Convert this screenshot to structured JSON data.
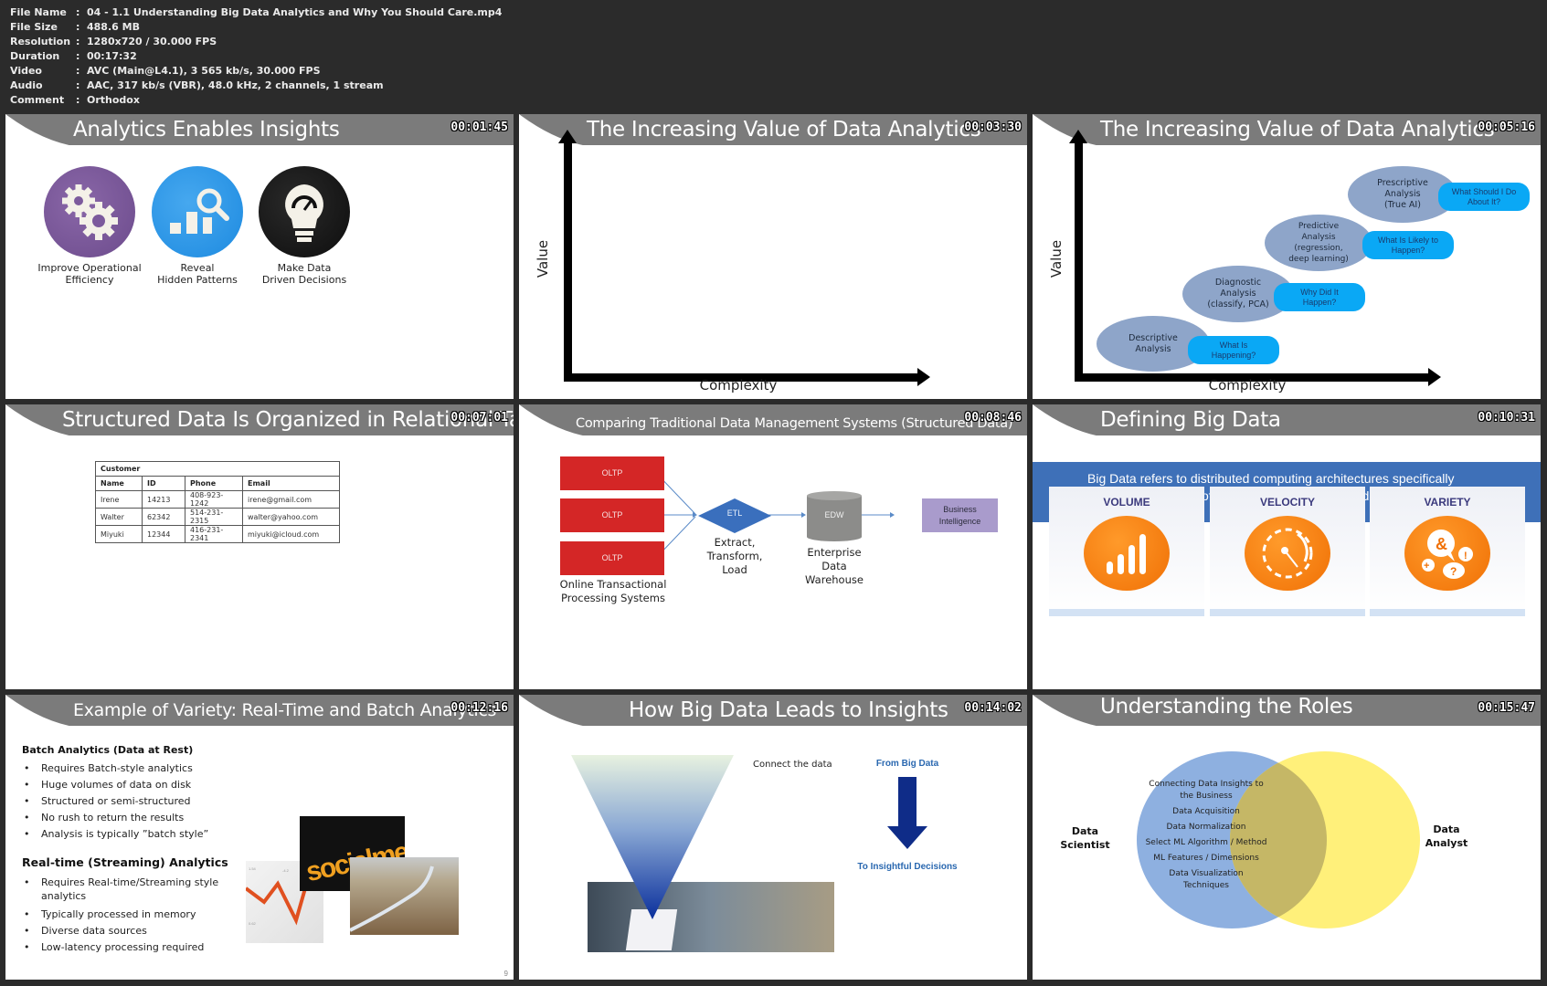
{
  "file_info": [
    {
      "key": "File Name",
      "value": "04 - 1.1 Understanding Big Data Analytics and Why You Should Care.mp4"
    },
    {
      "key": "File Size",
      "value": "488.6 MB"
    },
    {
      "key": "Resolution",
      "value": "1280x720 / 30.000 FPS"
    },
    {
      "key": "Duration",
      "value": "00:17:32"
    },
    {
      "key": "Video",
      "value": "AVC (Main@L4.1), 3 565 kb/s, 30.000 FPS"
    },
    {
      "key": "Audio",
      "value": "AAC, 317 kb/s (VBR), 48.0 kHz, 2 channels, 1 stream"
    },
    {
      "key": "Comment",
      "value": "Orthodox"
    }
  ],
  "separator": ":",
  "colors": {
    "header_gray": "#7b7b7b",
    "background": "#2b2b2b",
    "oltp_red": "#d42626",
    "etl_blue": "#3a6fbd",
    "bi_purple": "#a99bcc",
    "orange": "#f07005",
    "venn_blue": "#8eb0e0",
    "venn_yellow": "#fff07a"
  },
  "slides": [
    {
      "title": "Analytics Enables Insights",
      "timestamp": "00:01:45",
      "items": [
        {
          "icon": "gears-icon",
          "label": "Improve Operational\nEfficiency"
        },
        {
          "icon": "bar-chart-magnifier-icon",
          "label": "Reveal\nHidden Patterns"
        },
        {
          "icon": "lightbulb-gauge-icon",
          "label": "Make Data\nDriven Decisions"
        }
      ]
    },
    {
      "title": "The Increasing Value of Data Analytics",
      "timestamp": "00:03:30",
      "y_axis": "Value",
      "x_axis": "Complexity"
    },
    {
      "title": "The Increasing Value of Data Analytics",
      "timestamp": "00:05:16",
      "y_axis": "Value",
      "x_axis": "Complexity",
      "stages": [
        {
          "name": "Descriptive\nAnalysis",
          "question": "What Is\nHappening?"
        },
        {
          "name": "Diagnostic\nAnalysis\n(classify, PCA)",
          "question": "Why Did It\nHappen?"
        },
        {
          "name": "Predictive\nAnalysis\n(regression,\ndeep learning)",
          "question": "What Is Likely to\nHappen?"
        },
        {
          "name": "Prescriptive\nAnalysis\n(True AI)",
          "question": "What Should I Do\nAbout It?"
        }
      ]
    },
    {
      "title": "Structured Data Is Organized in Relational Tables",
      "timestamp": "00:07:01",
      "table": {
        "name": "Customer",
        "columns": [
          "Name",
          "ID",
          "Phone",
          "Email"
        ],
        "rows": [
          [
            "Irene",
            "14213",
            "408-923-1242",
            "irene@gmail.com"
          ],
          [
            "Walter",
            "62342",
            "514-231-2315",
            "walter@yahoo.com"
          ],
          [
            "Miyuki",
            "12344",
            "416-231-2341",
            "miyuki@icloud.com"
          ]
        ]
      }
    },
    {
      "title": "Comparing Traditional Data Management Systems (Structured Data)",
      "timestamp": "00:08:46",
      "oltp_label": "OLTP",
      "oltp_caption": "Online Transactional\nProcessing Systems",
      "etl_label": "ETL",
      "etl_caption": "Extract,\nTransform,\nLoad",
      "edw_label": "EDW",
      "edw_caption": "Enterprise\nData\nWarehouse",
      "bi_label": "Business\nIntelligence"
    },
    {
      "title": "Defining Big Data",
      "timestamp": "00:10:31",
      "banner": "Big Data refers to distributed computing architectures specifically aimed at the “3 V’s” of data: Volume, Velocity, and Variety",
      "vs": [
        {
          "label": "VOLUME",
          "icon": "signal-bars-icon"
        },
        {
          "label": "VELOCITY",
          "icon": "speedometer-icon"
        },
        {
          "label": "VARIETY",
          "icon": "speech-bubbles-icon"
        }
      ]
    },
    {
      "title": "Example of Variety: Real-Time and Batch Analytics",
      "timestamp": "00:12:16",
      "batch_heading": "Batch Analytics (Data at Rest)",
      "batch_items": [
        "Requires Batch-style analytics",
        "Huge volumes of data on disk",
        "Structured or semi-structured",
        "No rush to return the results",
        "Analysis is typically ”batch style”"
      ],
      "stream_heading": "Real-time (Streaming) Analytics",
      "stream_items": [
        "Requires Real-time/Streaming style analytics",
        "Typically processed in memory",
        "Diverse data sources",
        "Low-latency processing required"
      ],
      "image_text": "socialmedia",
      "page_number": "9"
    },
    {
      "title": "How Big Data Leads to Insights",
      "timestamp": "00:14:02",
      "connect_label": "Connect the data",
      "from_label": "From Big Data",
      "to_label": "To Insightful Decisions"
    },
    {
      "title": "Understanding the Roles",
      "timestamp": "00:15:47",
      "left_role": "Data\nScientist",
      "right_role": "Data\nAnalyst",
      "skills": [
        "Connecting Data Insights to\nthe Business",
        "Data Acquisition",
        "Data Normalization",
        "Select ML Algorithm / Method",
        "ML Features / Dimensions",
        "Data Visualization\nTechniques"
      ]
    }
  ]
}
